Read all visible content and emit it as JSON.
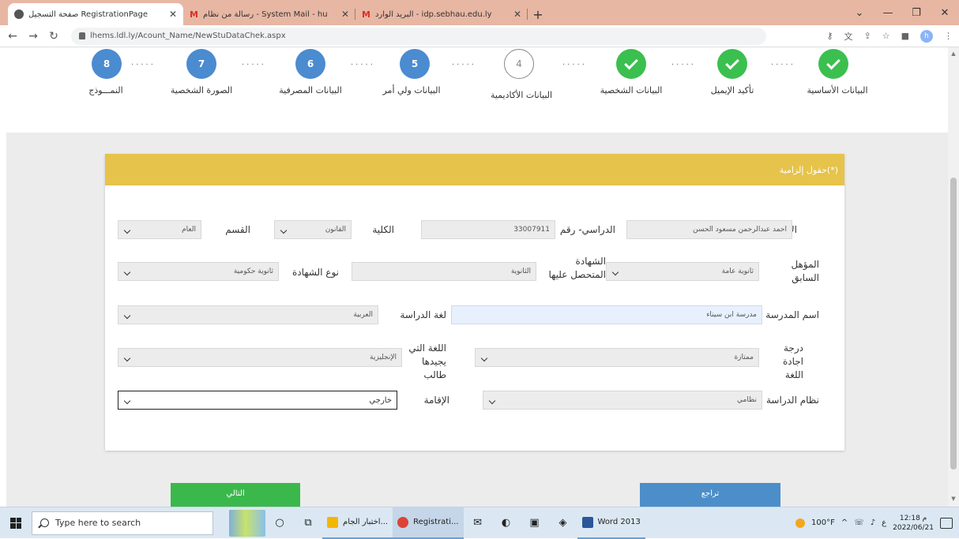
{
  "browser": {
    "tabs": [
      {
        "title": "صفحة التسجيل RegistrationPage",
        "active": true
      },
      {
        "title": "رسالة من نظام - System Mail - hu",
        "active": false
      },
      {
        "title": "البريد الوارد - idp.sebhau.edu.ly",
        "active": false
      }
    ],
    "new_tab": "+",
    "url": "lhems.ldl.ly/Acount_Name/NewStuDataChek.aspx",
    "profile_initial": "h"
  },
  "stepper": {
    "steps": [
      {
        "label": "البيانات الأساسية",
        "state": "done"
      },
      {
        "label": "تأكيد الإيميل",
        "state": "done"
      },
      {
        "label": "البيانات الشخصية",
        "state": "done"
      },
      {
        "number": "4",
        "label": "البيانات الأكاديمية",
        "state": "current"
      },
      {
        "number": "5",
        "label": "البيانات ولي أمر",
        "state": "pending"
      },
      {
        "number": "6",
        "label": "البيانات المصرفية",
        "state": "pending"
      },
      {
        "number": "7",
        "label": "الصورة الشخصية",
        "state": "pending"
      },
      {
        "number": "8",
        "label": "النمـــوذج",
        "state": "pending"
      }
    ],
    "dots": "....."
  },
  "form": {
    "header": "(*)حقول إلزامية",
    "name": {
      "label": "الاسم",
      "value": "احمد عبدالرحمن مسعود الحسن"
    },
    "student_number": {
      "label": "الدراسي- رقم",
      "value": "33007911"
    },
    "faculty": {
      "label": "الكلية",
      "value": "القانون"
    },
    "department": {
      "label": "القسم",
      "value": "العام"
    },
    "prev_qualification": {
      "label": "المؤهل السابق",
      "value": "ثانوية عامة"
    },
    "certificate": {
      "label": "الشهادة المتحصل عليها",
      "value": "الثانوية"
    },
    "certificate_type": {
      "label": "نوع الشهادة",
      "value": "ثانوية حكومية"
    },
    "school_name": {
      "label": "اسم المدرسة",
      "value": "مدرسة ابن سيناء"
    },
    "study_language": {
      "label": "لغة الدراسة",
      "value": "العربية"
    },
    "language_level": {
      "label": "درجة اجادة اللغة",
      "value": "ممتازة"
    },
    "foreign_language": {
      "label": "اللغة التي يجيدها طالب",
      "value": "الإنجليزية"
    },
    "study_system": {
      "label": "نظام الدراسة",
      "value": "نظامي"
    },
    "residence": {
      "label": "الإقامة",
      "value": "خارجي"
    }
  },
  "buttons": {
    "next": "التالي",
    "back": "تراجع"
  },
  "taskbar": {
    "search_placeholder": "Type here to search",
    "apps": [
      {
        "label": "اختبار الجام...",
        "color": "#f2b705"
      },
      {
        "label": "Registrati...",
        "color": "#db4437",
        "active": true
      },
      {
        "label": "Word 2013",
        "color": "#2b579a"
      }
    ],
    "temperature": "100°F",
    "time": "12:18 م",
    "date": "2022/06/21",
    "lang": "ع"
  }
}
